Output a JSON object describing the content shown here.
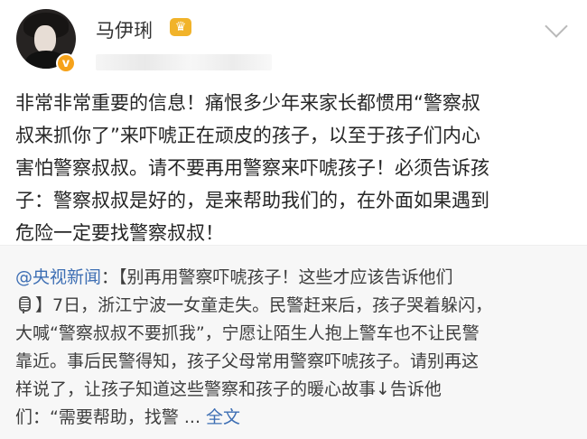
{
  "post": {
    "author": "马伊琍",
    "avatar_icon": "avatar-photo",
    "verified_icon": "verified-badge-icon",
    "crown_icon": "vip-crown-icon",
    "more_icon": "chevron-down-icon",
    "text": "非常非常重要的信息！痛恨多少年来家长都惯用“警察叔\n叔来抓你了”来吓唬正在顽皮的孩子，以至于孩子们内心\n害怕警察叔叔。请不要再用警察来吓唬孩子！必须告诉孩\n子：警察叔叔是好的，是来帮助我们的，在外面如果遇到\n危险一定要找警察叔叔！"
  },
  "repost": {
    "source": "@央视新闻",
    "title_line": "：【别再用警察吓唬孩子！这些才应该告诉他们\n",
    "body": "】7日，浙江宁波一女童走失。民警赶来后，孩子哭着躲闪，\n大喊“警察叔叔不要抓我”，宁愿让陌生人抱上警车也不让民警\n靠近。事后民警得知，孩子父母常用警察吓唬孩子。请别再这\n样说了，让孩子知道这些警察和孩子的暖心故事↓告诉他\n们：“需要帮助，找警 ... ",
    "full_text": "全文"
  }
}
